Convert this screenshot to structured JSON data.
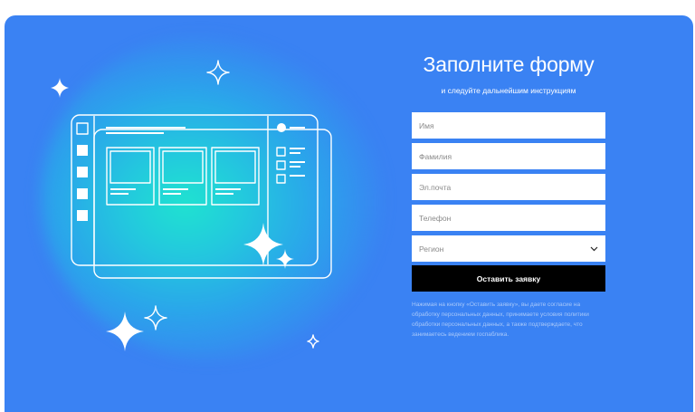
{
  "form": {
    "title": "Заполните форму",
    "subtitle": "и следуйте дальнейшим инструкциям",
    "fields": {
      "name_placeholder": "Имя",
      "surname_placeholder": "Фамилия",
      "email_placeholder": "Эл.почта",
      "phone_placeholder": "Телефон"
    },
    "region": {
      "selected": "Регион",
      "icon": "chevron-down-icon"
    },
    "submit_label": "Оставить заявку",
    "consent_text": "Нажимая на кнопку «Оставить заявку», вы даете согласие на обработку персональных данных, принимаете условия политики обработки персональных данных, а также подтверждаете, что занимаетесь ведением госпаблика."
  },
  "illustration": {
    "icons": [
      "sparkle-icon",
      "dashboard-window-icon"
    ]
  },
  "colors": {
    "background": "#3a82f3",
    "glow": "#1fe3d0",
    "button": "#000000",
    "field": "#ffffff"
  }
}
